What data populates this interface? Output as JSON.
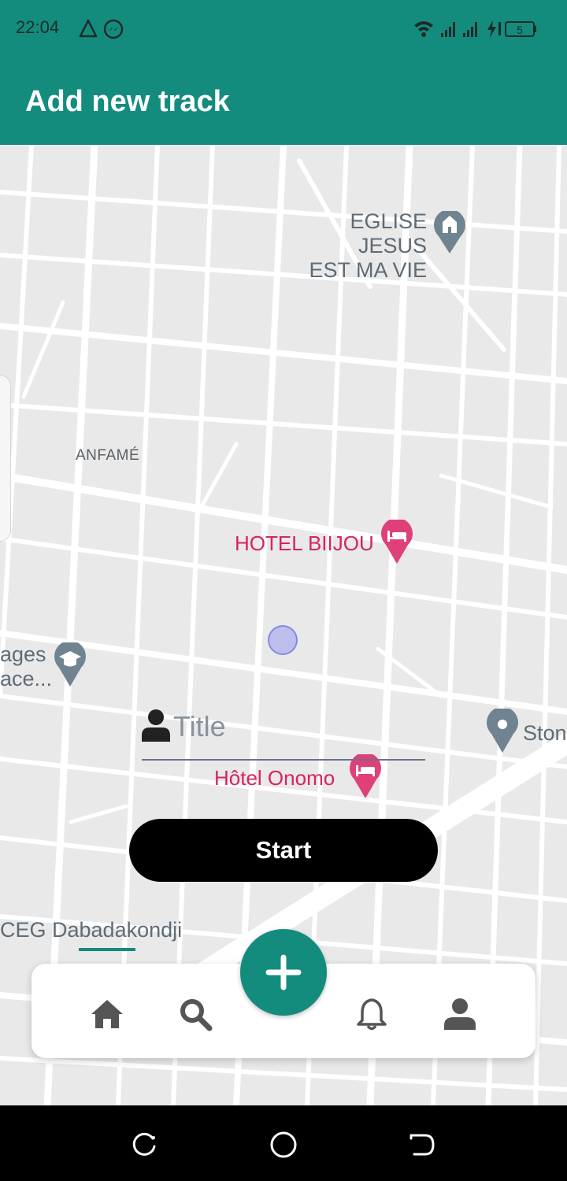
{
  "status_bar": {
    "time": "22:04",
    "left_icons": [
      "alert-triangle-icon",
      "messenger-icon"
    ],
    "right_icons": [
      "wifi-icon",
      "signal-icon",
      "signal-icon",
      "charging-icon"
    ],
    "battery": "5"
  },
  "app_bar": {
    "title": "Add new track"
  },
  "map": {
    "pois": [
      {
        "label_line1": "EGLISE JESUS",
        "label_line2": "EST MA VIE",
        "icon": "church-pin-icon",
        "color": "#5f6b75"
      },
      {
        "label": "ANFAMÉ",
        "type": "area"
      },
      {
        "label": "HOTEL BIIJOU",
        "icon": "hotel-pin-icon",
        "color": "#e0407a"
      },
      {
        "label_line1": "ages",
        "label_line2": "ace...",
        "icon": "school-pin-icon",
        "color": "#5f6b75"
      },
      {
        "label": "Ston",
        "icon": "place-pin-icon",
        "color": "#5f6b75"
      },
      {
        "label": "Hôtel Onomo",
        "icon": "hotel-pin-icon",
        "color": "#e0407a"
      },
      {
        "label": "CEG Dabadakondji",
        "type": "place"
      }
    ]
  },
  "form": {
    "title_placeholder": "Title",
    "title_value": "",
    "person_icon": "person-icon",
    "start_label": "Start"
  },
  "bottom_nav": {
    "items": [
      "home-icon",
      "search-icon",
      "add-icon",
      "bell-icon",
      "profile-icon"
    ],
    "accent": "#138c7e"
  },
  "system_nav": [
    "recents-icon",
    "home-circle-icon",
    "back-icon"
  ]
}
